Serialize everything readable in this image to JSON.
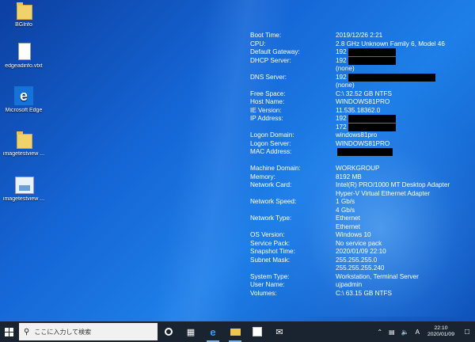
{
  "desktop": {
    "icons": [
      {
        "label": "BGInfo",
        "icon": "folder-icon"
      },
      {
        "label": "edgeadinfo.vtxt",
        "icon": "document-icon"
      },
      {
        "label": "Microsoft Edge",
        "icon": "edge-icon"
      },
      {
        "label": "imagetestview ...",
        "icon": "folder-icon"
      },
      {
        "label": "imagetestview ...",
        "icon": "image-icon"
      }
    ]
  },
  "bginfo": {
    "rows": [
      {
        "key": "Boot Time:",
        "value": "2019/12/26 2:21"
      },
      {
        "key": "CPU:",
        "value": "2.8 GHz Unknown Family 6, Model 46"
      },
      {
        "key": "Default Gateway:",
        "value": "192",
        "redacted": true
      },
      {
        "key": "DHCP Server:",
        "value": "192",
        "redacted": true
      },
      {
        "key": "",
        "value": "(none)"
      },
      {
        "key": "DNS Server:",
        "value": "192",
        "redacted": true
      },
      {
        "key": "",
        "value": "(none)"
      },
      {
        "key": "Free Space:",
        "value": "C:\\ 32.52 GB NTFS"
      },
      {
        "key": "Host Name:",
        "value": "WINDOWS81PRO"
      },
      {
        "key": "IE Version:",
        "value": "11.535.18362.0"
      },
      {
        "key": "IP Address:",
        "value": "192",
        "redacted": true
      },
      {
        "key": "",
        "value": "172",
        "redacted": true
      },
      {
        "key": "Logon Domain:",
        "value": "windows81pro"
      },
      {
        "key": "Logon Server:",
        "value": "WINDOWS81PRO"
      },
      {
        "key": "MAC Address:",
        "value": "",
        "redacted": true
      },
      {
        "key": "",
        "value": ""
      },
      {
        "key": "Machine Domain:",
        "value": "WORKGROUP"
      },
      {
        "key": "Memory:",
        "value": "8192 MB"
      },
      {
        "key": "Network Card:",
        "value": "Intel(R) PRO/1000 MT Desktop Adapter"
      },
      {
        "key": "",
        "value": "Hyper-V Virtual Ethernet Adapter"
      },
      {
        "key": "Network Speed:",
        "value": "1 Gb/s"
      },
      {
        "key": "",
        "value": "4 Gb/s"
      },
      {
        "key": "Network Type:",
        "value": "Ethernet"
      },
      {
        "key": "",
        "value": "Ethernet"
      },
      {
        "key": "OS Version:",
        "value": "Windows 10"
      },
      {
        "key": "Service Pack:",
        "value": "No service pack"
      },
      {
        "key": "Snapshot Time:",
        "value": "2020/01/09 22:10"
      },
      {
        "key": "Subnet Mask:",
        "value": "255.255.255.0"
      },
      {
        "key": "",
        "value": "255.255.255.240"
      },
      {
        "key": "System Type:",
        "value": "Workstation, Terminal Server"
      },
      {
        "key": "User Name:",
        "value": "ujpadmin"
      },
      {
        "key": "Volumes:",
        "value": "C:\\ 63.15 GB NTFS"
      }
    ]
  },
  "taskbar": {
    "search_placeholder": "ここに入力して検索",
    "apps": [
      "cortana-icon",
      "task-view-icon",
      "edge-icon",
      "file-explorer-icon",
      "store-icon",
      "mail-icon"
    ],
    "tray": {
      "ime": "A",
      "time": "22:10",
      "date": "2020/01/09"
    }
  }
}
